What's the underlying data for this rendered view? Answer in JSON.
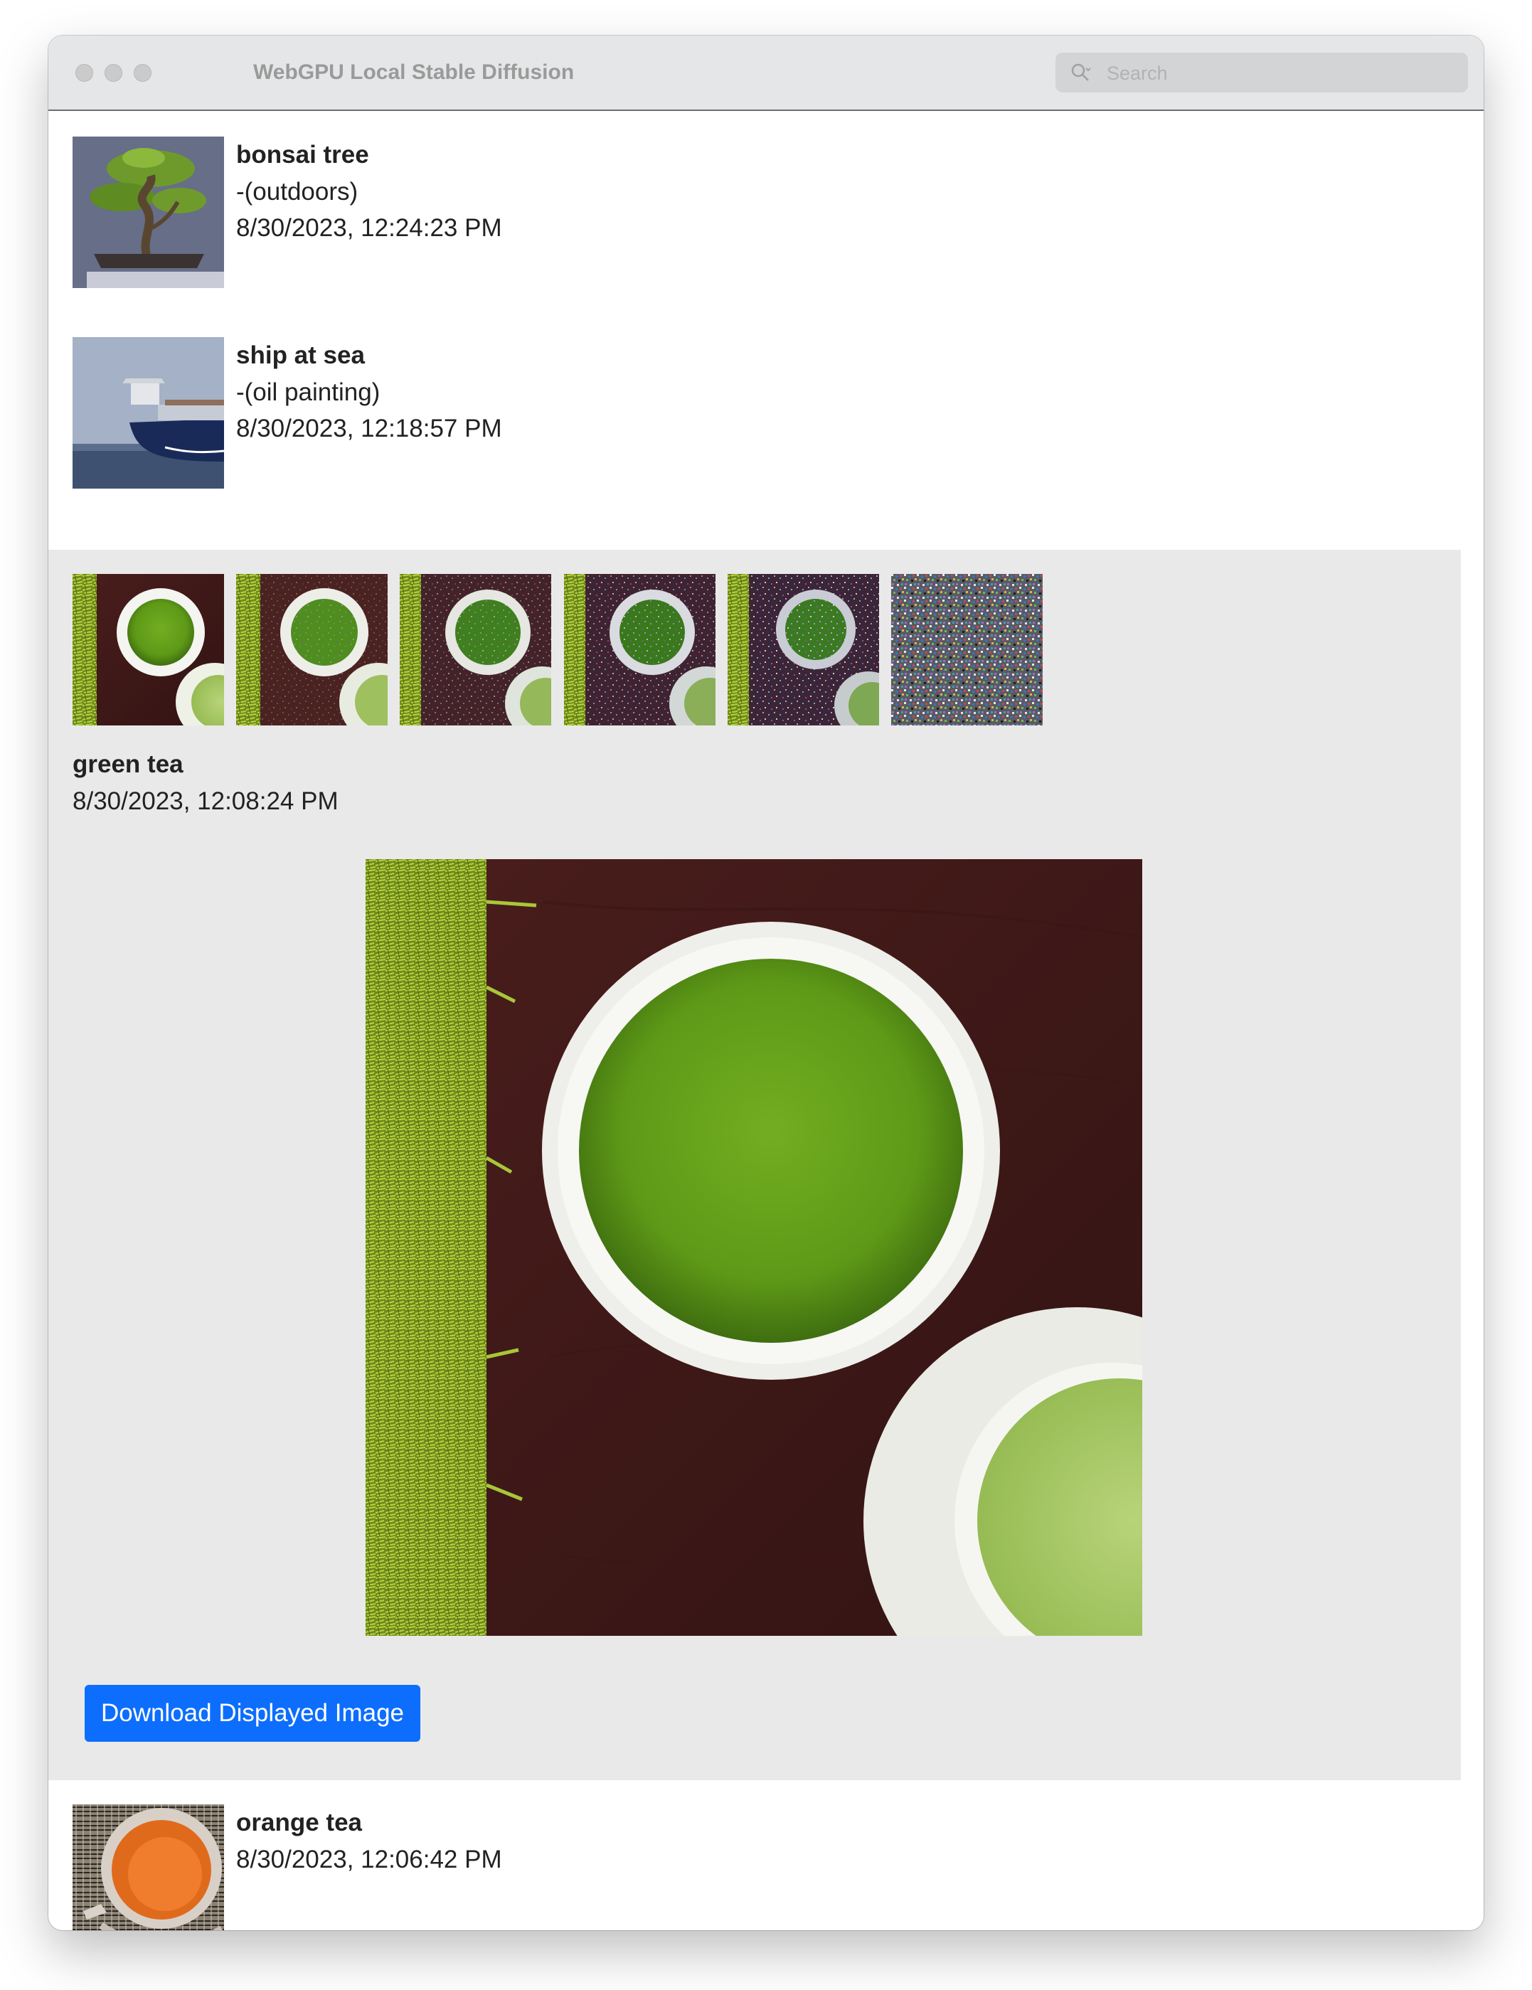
{
  "window": {
    "title": "WebGPU Local Stable Diffusion",
    "search_placeholder": "Search"
  },
  "history": [
    {
      "prompt": "bonsai tree",
      "modifier": "-(outdoors)",
      "timestamp": "8/30/2023, 12:24:23 PM",
      "thumbnail": "bonsai-tree-image"
    },
    {
      "prompt": "ship at sea",
      "modifier": "-(oil painting)",
      "timestamp": "8/30/2023, 12:18:57 PM",
      "thumbnail": "ship-image"
    },
    {
      "prompt": "green tea",
      "timestamp": "8/30/2023, 12:08:24 PM",
      "steps_shown": 6,
      "selected_step": 1,
      "thumbnail": "green-tea-image"
    },
    {
      "prompt": "orange tea",
      "timestamp": "8/30/2023, 12:06:42 PM",
      "thumbnail": "orange-tea-image"
    }
  ],
  "actions": {
    "download_label": "Download Displayed Image"
  },
  "colors": {
    "accent": "#0d6efd",
    "expanded_bg": "#e9e9e9",
    "titlebar_bg": "#e5e6e7"
  }
}
